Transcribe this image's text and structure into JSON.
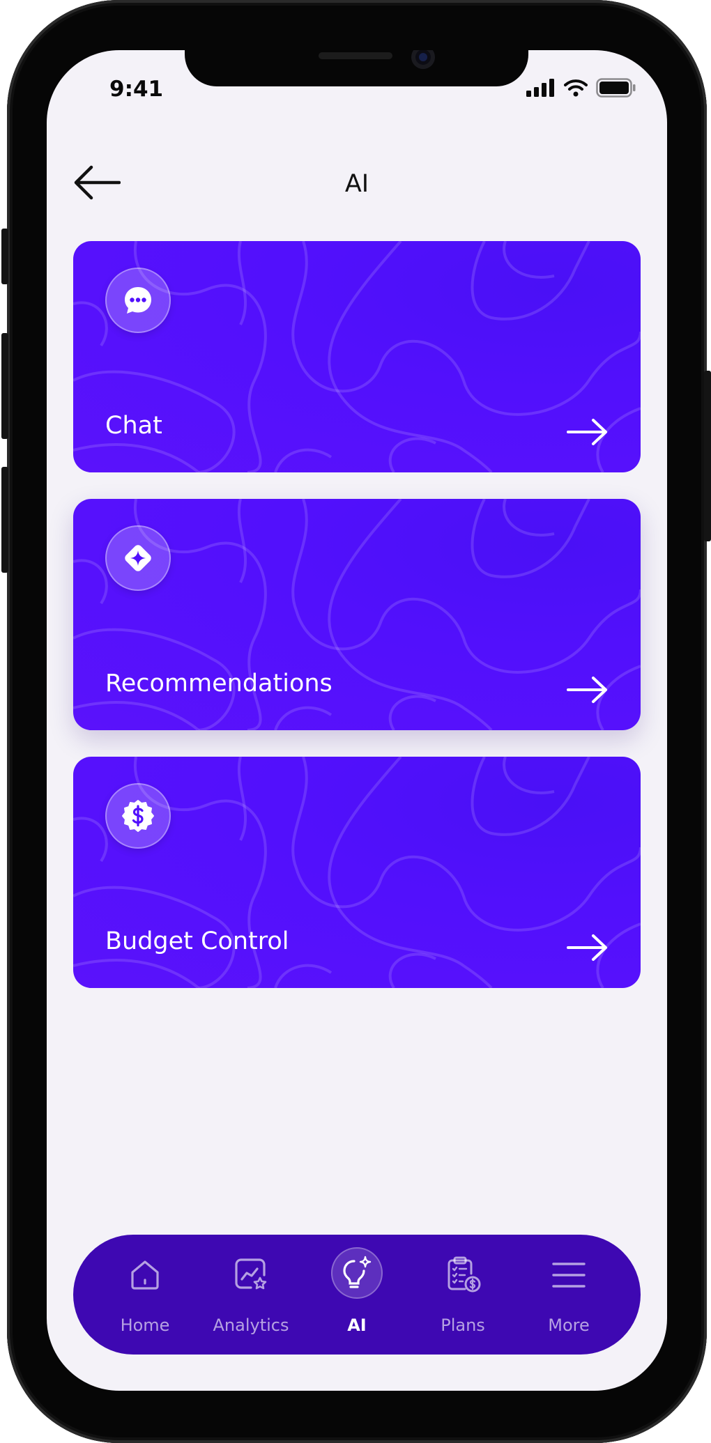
{
  "status_bar": {
    "time": "9:41"
  },
  "header": {
    "title": "AI"
  },
  "cards": [
    {
      "label": "Chat",
      "icon": "chat-bubble-icon"
    },
    {
      "label": "Recommendations",
      "icon": "sparkle-diamond-icon"
    },
    {
      "label": "Budget Control",
      "icon": "dollar-badge-icon"
    }
  ],
  "tabbar": {
    "tabs": [
      {
        "label": "Home",
        "icon": "home-icon",
        "active": false
      },
      {
        "label": "Analytics",
        "icon": "analytics-chart-icon",
        "active": false
      },
      {
        "label": "AI",
        "icon": "lightbulb-sparkle-icon",
        "active": true
      },
      {
        "label": "Plans",
        "icon": "plans-clipboard-icon",
        "active": false
      },
      {
        "label": "More",
        "icon": "menu-icon",
        "active": false
      }
    ]
  },
  "colors": {
    "card_background": "#5210fc",
    "tabbar_background": "#3e08b2",
    "screen_background": "#f4f2f8"
  }
}
